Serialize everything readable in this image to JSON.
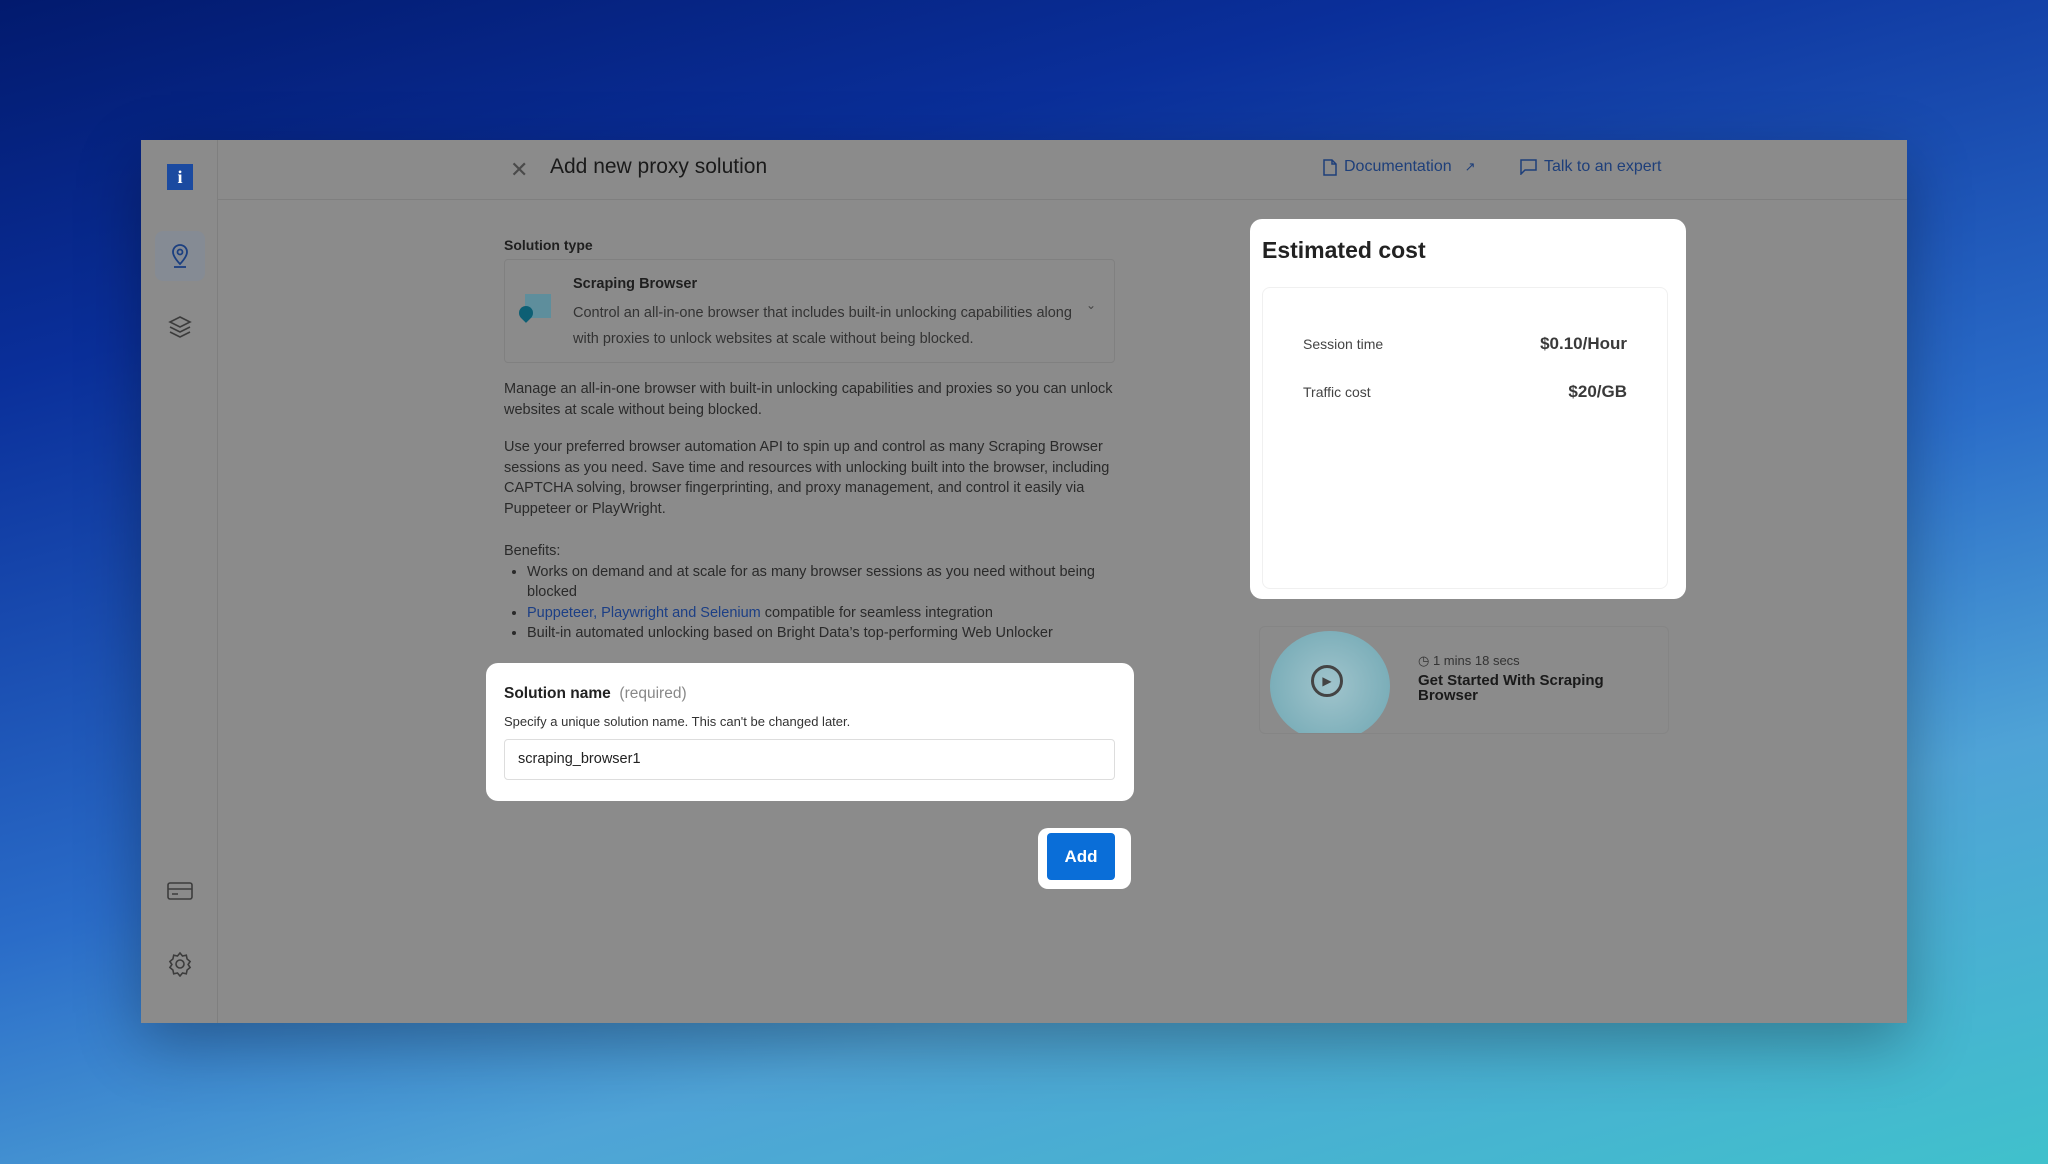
{
  "header": {
    "title": "Add new proxy solution",
    "documentation": "Documentation",
    "talk": "Talk to an expert"
  },
  "sidebar": {
    "logo": "i",
    "items": [
      "location-pin-icon",
      "layers-icon",
      "billing-card-icon",
      "settings-gear-icon"
    ]
  },
  "solution_type": {
    "label": "Solution type",
    "selected_title": "Scraping Browser",
    "selected_desc": "Control an all-in-one browser that includes built-in unlocking capabilities along with proxies to unlock websites at scale without being blocked."
  },
  "description": {
    "p1": "Manage an all-in-one browser with built-in unlocking capabilities and proxies so you can unlock websites at scale without being blocked.",
    "p2": "Use your preferred browser automation API to spin up and control as many Scraping Browser sessions as you need. Save time and resources with unlocking built into the browser, including CAPTCHA solving, browser fingerprinting, and proxy management, and control it easily via Puppeteer or PlayWright.",
    "benefits_label": "Benefits:",
    "b1": "Works on demand and at scale for as many browser sessions as you need without being blocked",
    "b2_link": "Puppeteer, Playwright and Selenium",
    "b2_rest": " compatible for seamless integration",
    "b3": "Built-in automated unlocking based on Bright Data’s top-performing Web Unlocker"
  },
  "solution_name": {
    "label": "Solution name",
    "required": "(required)",
    "hint": "Specify a unique solution name. This can't be changed later.",
    "value": "scraping_browser1"
  },
  "add_button": "Add",
  "cost": {
    "title": "Estimated cost",
    "rows": [
      {
        "label": "Session time",
        "value": "$0.10/Hour"
      },
      {
        "label": "Traffic cost",
        "value": "$20/GB"
      }
    ]
  },
  "video": {
    "duration": "1 mins 18 secs",
    "title": "Get Started With Scraping Browser"
  },
  "colors": {
    "accent": "#0a6ed8",
    "overlay": "#8b8b8b"
  }
}
